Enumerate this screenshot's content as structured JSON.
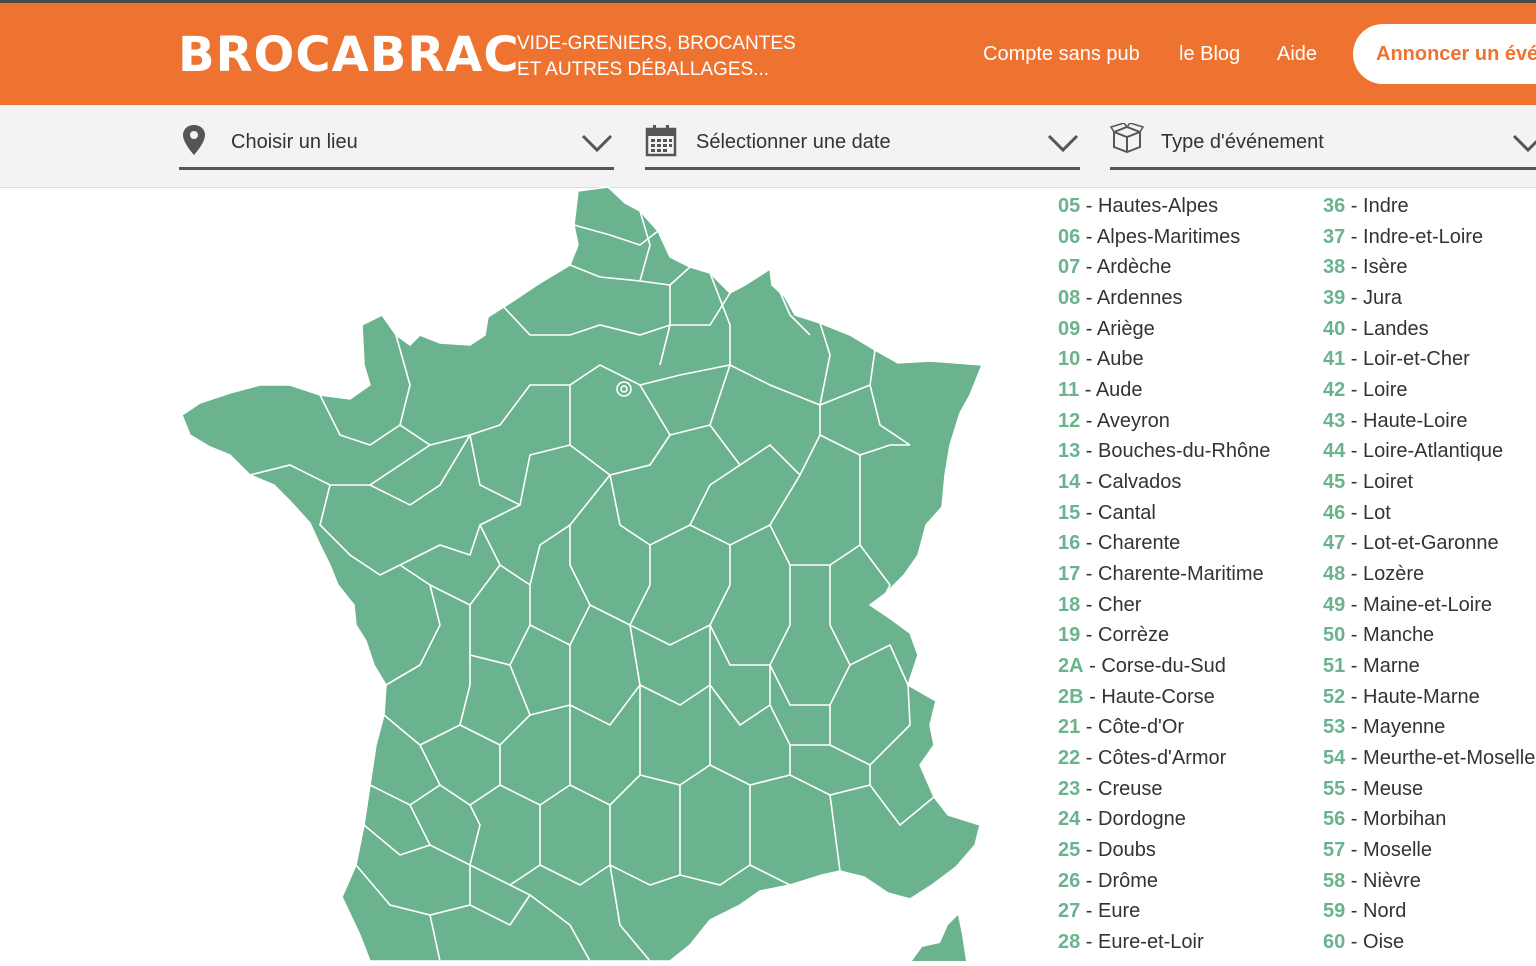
{
  "brand": {
    "logo": "BROCABRAC",
    "tagline_line1": "VIDE-GRENIERS, BROCANTES",
    "tagline_line2": "ET AUTRES DÉBALLAGES..."
  },
  "nav": {
    "account": "Compte sans pub",
    "blog": "le Blog",
    "help": "Aide",
    "cta": "Annoncer un événement"
  },
  "filters": {
    "place": "Choisir un lieu",
    "date": "Sélectionner une date",
    "type": "Type d'événement"
  },
  "colors": {
    "brand_orange": "#ef7330",
    "map_green": "#6bb38e",
    "code_green": "#6bb38e"
  },
  "departments_col1": [
    {
      "code": "05",
      "name": "Hautes-Alpes"
    },
    {
      "code": "06",
      "name": "Alpes-Maritimes"
    },
    {
      "code": "07",
      "name": "Ardèche"
    },
    {
      "code": "08",
      "name": "Ardennes"
    },
    {
      "code": "09",
      "name": "Ariège"
    },
    {
      "code": "10",
      "name": "Aube"
    },
    {
      "code": "11",
      "name": "Aude"
    },
    {
      "code": "12",
      "name": "Aveyron"
    },
    {
      "code": "13",
      "name": "Bouches-du-Rhône"
    },
    {
      "code": "14",
      "name": "Calvados"
    },
    {
      "code": "15",
      "name": "Cantal"
    },
    {
      "code": "16",
      "name": "Charente"
    },
    {
      "code": "17",
      "name": "Charente-Maritime"
    },
    {
      "code": "18",
      "name": "Cher"
    },
    {
      "code": "19",
      "name": "Corrèze"
    },
    {
      "code": "2A",
      "name": "Corse-du-Sud"
    },
    {
      "code": "2B",
      "name": "Haute-Corse"
    },
    {
      "code": "21",
      "name": "Côte-d'Or"
    },
    {
      "code": "22",
      "name": "Côtes-d'Armor"
    },
    {
      "code": "23",
      "name": "Creuse"
    },
    {
      "code": "24",
      "name": "Dordogne"
    },
    {
      "code": "25",
      "name": "Doubs"
    },
    {
      "code": "26",
      "name": "Drôme"
    },
    {
      "code": "27",
      "name": "Eure"
    },
    {
      "code": "28",
      "name": "Eure-et-Loir"
    }
  ],
  "departments_col2": [
    {
      "code": "36",
      "name": "Indre"
    },
    {
      "code": "37",
      "name": "Indre-et-Loire"
    },
    {
      "code": "38",
      "name": "Isère"
    },
    {
      "code": "39",
      "name": "Jura"
    },
    {
      "code": "40",
      "name": "Landes"
    },
    {
      "code": "41",
      "name": "Loir-et-Cher"
    },
    {
      "code": "42",
      "name": "Loire"
    },
    {
      "code": "43",
      "name": "Haute-Loire"
    },
    {
      "code": "44",
      "name": "Loire-Atlantique"
    },
    {
      "code": "45",
      "name": "Loiret"
    },
    {
      "code": "46",
      "name": "Lot"
    },
    {
      "code": "47",
      "name": "Lot-et-Garonne"
    },
    {
      "code": "48",
      "name": "Lozère"
    },
    {
      "code": "49",
      "name": "Maine-et-Loire"
    },
    {
      "code": "50",
      "name": "Manche"
    },
    {
      "code": "51",
      "name": "Marne"
    },
    {
      "code": "52",
      "name": "Haute-Marne"
    },
    {
      "code": "53",
      "name": "Mayenne"
    },
    {
      "code": "54",
      "name": "Meurthe-et-Moselle"
    },
    {
      "code": "55",
      "name": "Meuse"
    },
    {
      "code": "56",
      "name": "Morbihan"
    },
    {
      "code": "57",
      "name": "Moselle"
    },
    {
      "code": "58",
      "name": "Nièvre"
    },
    {
      "code": "59",
      "name": "Nord"
    },
    {
      "code": "60",
      "name": "Oise"
    }
  ]
}
